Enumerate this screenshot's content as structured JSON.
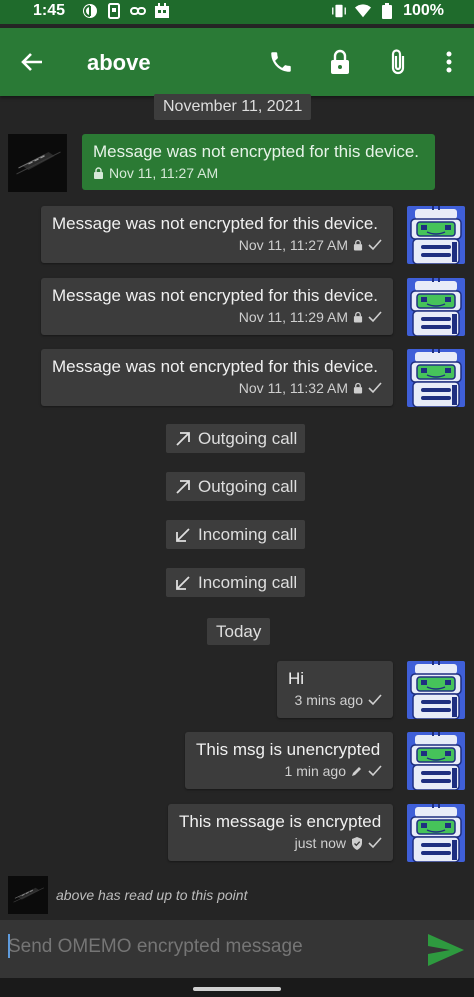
{
  "status_bar": {
    "time": "1:45",
    "battery": "100%"
  },
  "toolbar": {
    "title": "above"
  },
  "date_chips": {
    "first": "November 11, 2021",
    "second": "Today"
  },
  "messages": [
    {
      "text": "Message was not encrypted for this device.",
      "time": "Nov 11, 11:27 AM"
    },
    {
      "text": "Message was not encrypted for this device.",
      "time": "Nov 11, 11:27 AM"
    },
    {
      "text": "Message was not encrypted for this device.",
      "time": "Nov 11, 11:29 AM"
    },
    {
      "text": "Message was not encrypted for this device.",
      "time": "Nov 11, 11:32 AM"
    },
    {
      "text": "Hi",
      "time": "3 mins ago"
    },
    {
      "text": "This msg is unencrypted",
      "time": "1 min ago"
    },
    {
      "text": "This message is encrypted",
      "time": "just now"
    }
  ],
  "calls": [
    {
      "label": "Outgoing call",
      "direction": "outgoing"
    },
    {
      "label": "Outgoing call",
      "direction": "outgoing"
    },
    {
      "label": "Incoming call",
      "direction": "incoming"
    },
    {
      "label": "Incoming call",
      "direction": "incoming"
    }
  ],
  "read_marker": "above has read up to this point",
  "composer": {
    "placeholder": "Send OMEMO encrypted message"
  },
  "colors": {
    "toolbar": "#2a7a36",
    "status_bar": "#1f6b2c",
    "incoming_bubble": "#2b7a34",
    "outgoing_bubble": "#3c3c3c",
    "background": "#252525",
    "send_icon": "#2e9a3f"
  }
}
